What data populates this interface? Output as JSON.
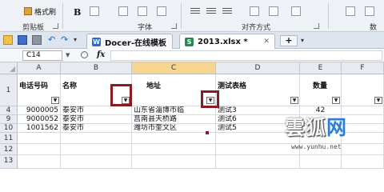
{
  "ribbon": {
    "format_painter_label": "格式刷",
    "bold_label": "B",
    "groups": [
      "剪贴板",
      "字体",
      "对齐方式",
      "数"
    ]
  },
  "tabbar": {
    "tabs": [
      {
        "label": "Docer-在线模板",
        "icon": "wps-writer-icon"
      },
      {
        "label": "2013.xlsx *",
        "icon": "spreadsheet-icon"
      }
    ],
    "new_tab_label": "+"
  },
  "formula_bar": {
    "name_box": "C14",
    "fx_label": "fx",
    "value": ""
  },
  "sheet": {
    "columns": [
      "A",
      "B",
      "C",
      "D",
      "E",
      "F"
    ],
    "selected_column": "C",
    "header_row": {
      "row_number": "1",
      "cells": [
        "电话号码",
        "名称",
        "地址",
        "测试表格",
        "数量",
        ""
      ]
    },
    "rows": [
      {
        "row_number": "4",
        "cells": [
          "9000005",
          "泰安市",
          "山东省淄博市临",
          "测试3",
          "42",
          ""
        ]
      },
      {
        "row_number": "9",
        "cells": [
          "9000052",
          "泰安市",
          "莒南县天桥路",
          "测试6",
          "",
          ""
        ]
      },
      {
        "row_number": "10",
        "cells": [
          "1001562",
          "泰安市",
          "潍坊市奎文区",
          "测试5",
          "",
          ""
        ]
      },
      {
        "row_number": "11",
        "cells": [
          "",
          "",
          "",
          "",
          "",
          ""
        ]
      },
      {
        "row_number": "12",
        "cells": [
          "",
          "",
          "",
          "",
          "",
          ""
        ]
      },
      {
        "row_number": "13",
        "cells": [
          "",
          "",
          "",
          "",
          "",
          ""
        ]
      }
    ],
    "accent_color": "#8b1a24"
  },
  "watermark": {
    "brand": "雲狐",
    "brand_suffix": "网",
    "url": "www.yunhu.net"
  }
}
